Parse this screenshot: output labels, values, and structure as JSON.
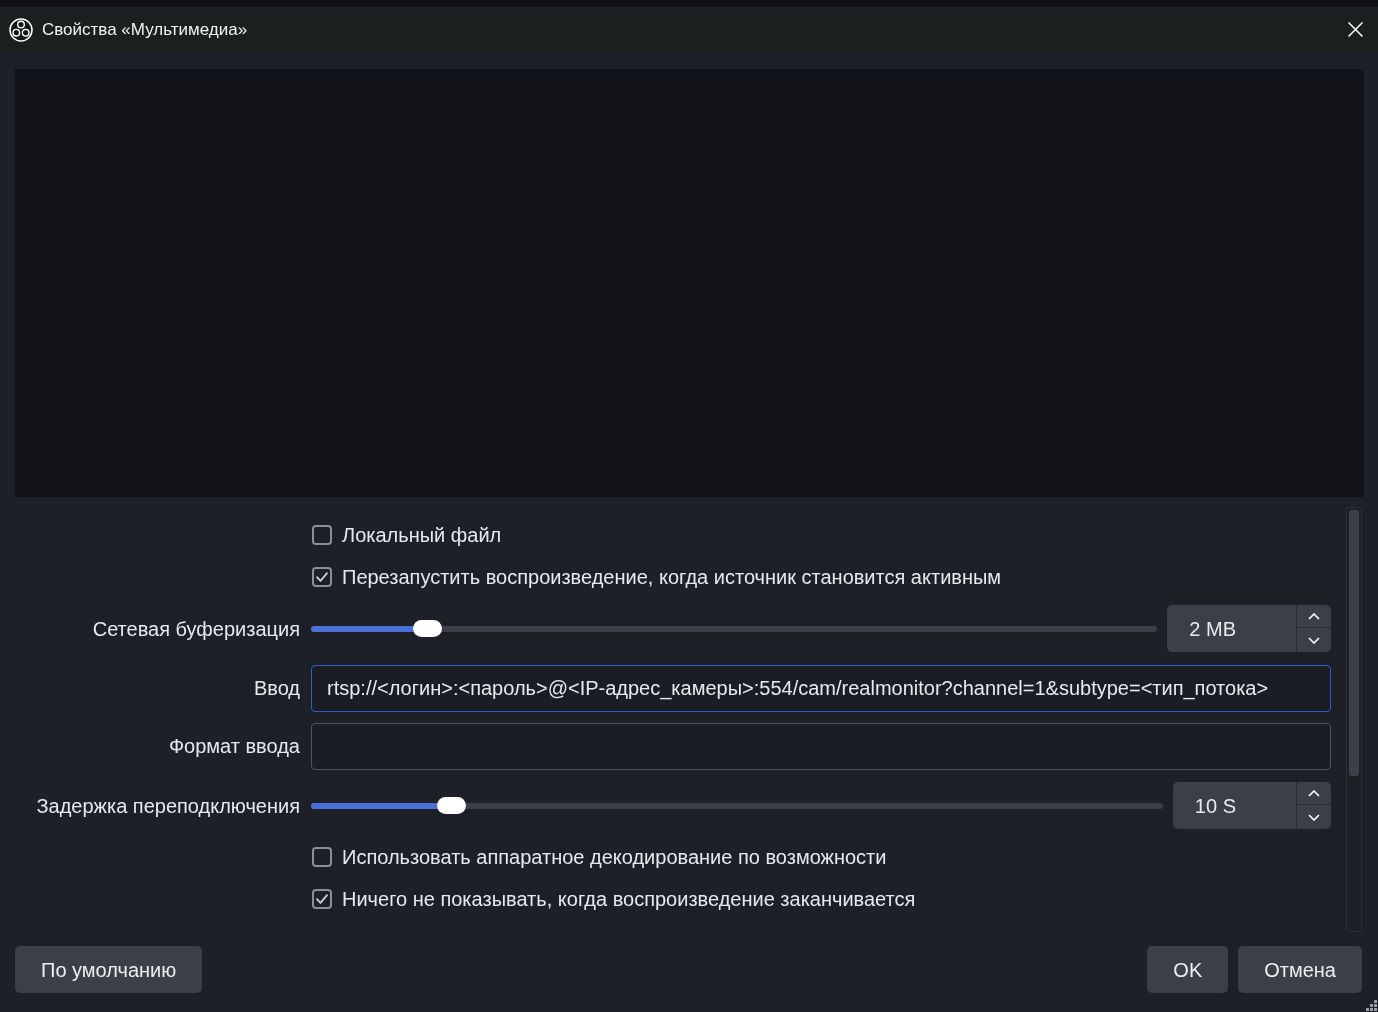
{
  "window": {
    "title": "Свойства «Мультимедиа»"
  },
  "properties": [
    {
      "kind": "checkbox",
      "label": "Локальный файл",
      "checked": false
    },
    {
      "kind": "checkbox",
      "label": "Перезапустить воспроизведение, когда источник становится активным",
      "checked": true
    },
    {
      "kind": "slider",
      "label": "Сетевая буферизация",
      "level": 0.125,
      "value": "2 MB"
    },
    {
      "kind": "text",
      "label": "Ввод",
      "value": "rtsp://<логин>:<пароль>@<IP-адрес_камеры>:554/cam/realmonitor?channel=1&subtype=<тип_потока>",
      "focused": true
    },
    {
      "kind": "text",
      "label": "Формат ввода",
      "focused": false
    },
    {
      "kind": "slider",
      "label": "Задержка переподключения",
      "level": 0.153,
      "value": "10 S"
    },
    {
      "kind": "checkbox",
      "label": "Использовать аппаратное декодирование по возможности",
      "checked": false
    },
    {
      "kind": "checkbox",
      "label": "Ничего не показывать, когда воспроизведение заканчивается",
      "checked": true
    }
  ],
  "buttons": {
    "left": [
      {
        "label": "По умолчанию"
      }
    ],
    "right": [
      {
        "label": "OK"
      },
      {
        "label": "Отмена"
      }
    ]
  }
}
